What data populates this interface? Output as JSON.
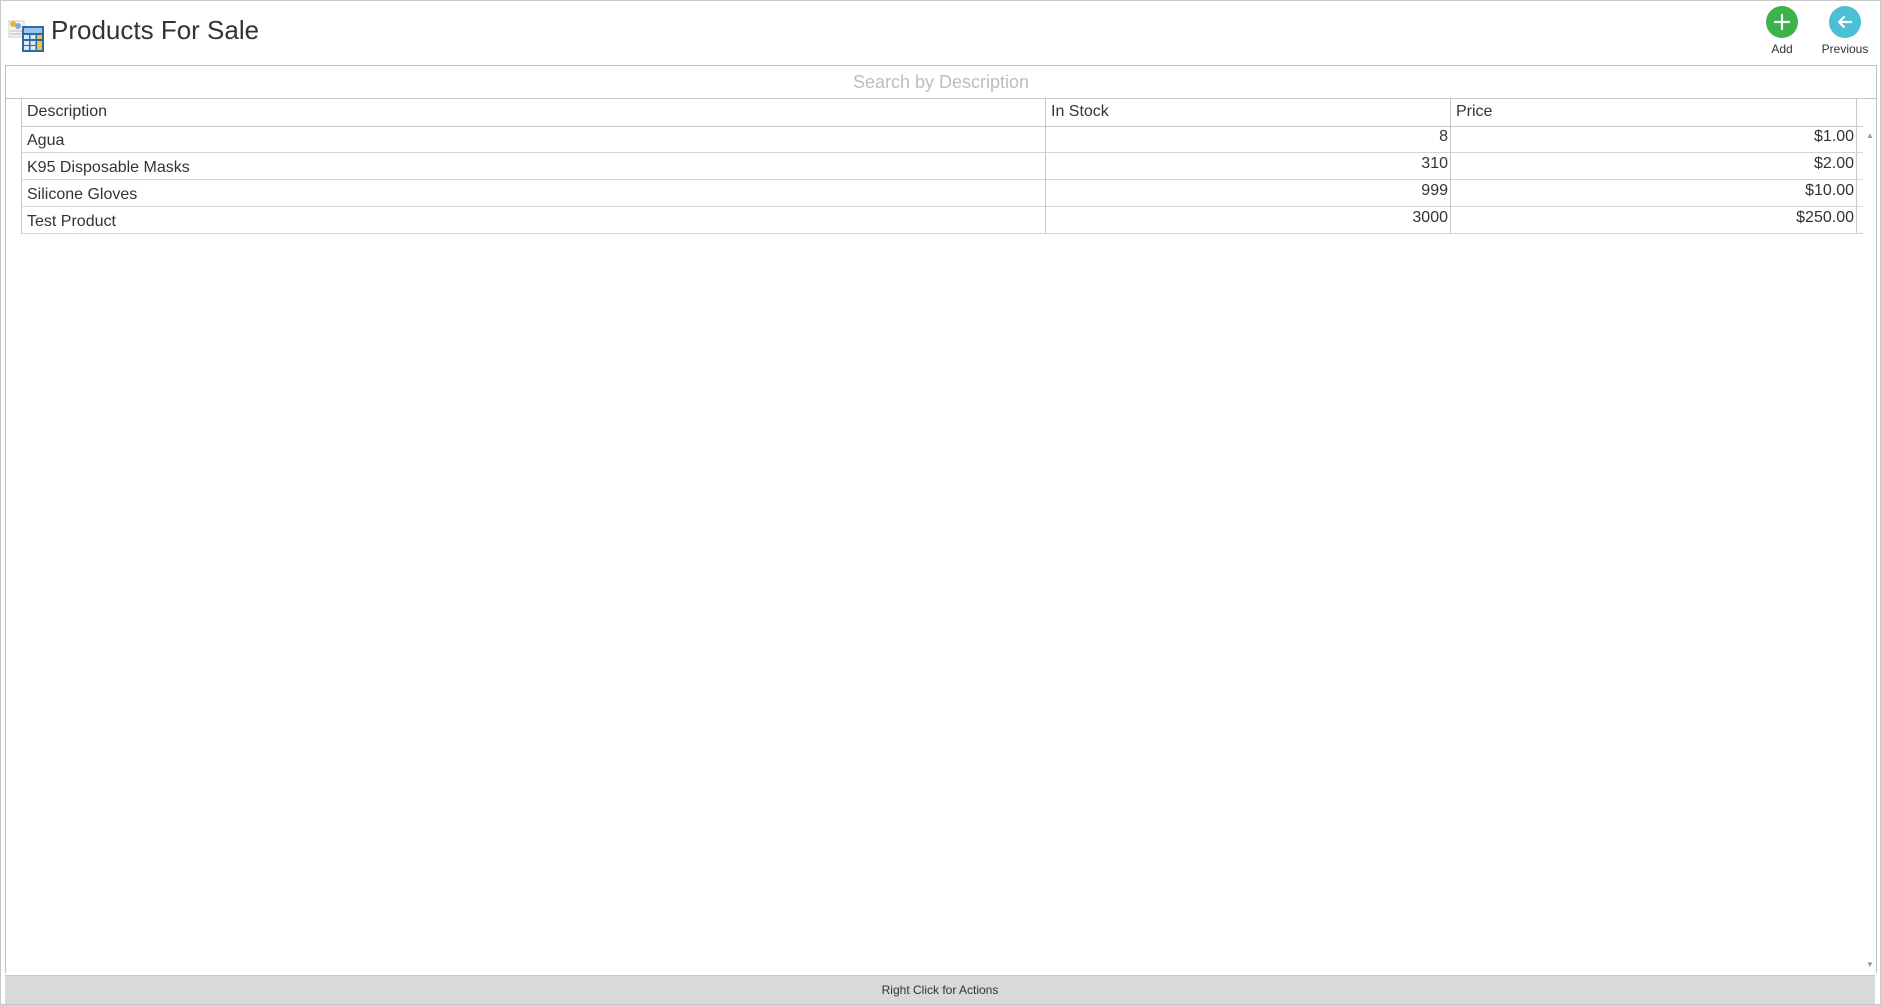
{
  "header": {
    "title": "Products For Sale",
    "app_icon": "calculator-spreadsheet-icon",
    "buttons": {
      "add": {
        "label": "Add",
        "icon": "plus-icon",
        "color": "#3bb24a"
      },
      "previous": {
        "label": "Previous",
        "icon": "arrow-left-icon",
        "color": "#4bbfd6"
      }
    }
  },
  "search": {
    "placeholder": "Search by Description",
    "value": ""
  },
  "table": {
    "columns": {
      "description": "Description",
      "in_stock": "In Stock",
      "price": "Price"
    },
    "rows": [
      {
        "description": "Agua",
        "in_stock": "8",
        "price": "$1.00"
      },
      {
        "description": "K95 Disposable Masks",
        "in_stock": "310",
        "price": "$2.00"
      },
      {
        "description": "Silicone Gloves",
        "in_stock": "999",
        "price": "$10.00"
      },
      {
        "description": "Test Product",
        "in_stock": "3000",
        "price": "$250.00"
      }
    ]
  },
  "status_bar": {
    "text": "Right Click for Actions"
  }
}
